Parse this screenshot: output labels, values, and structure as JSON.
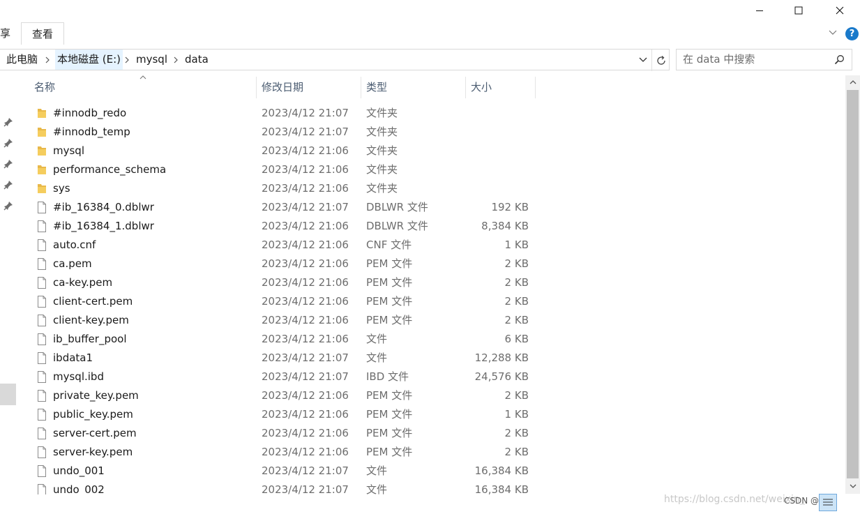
{
  "ribbon": {
    "tab_partial": "享",
    "tab_view": "查看"
  },
  "address": {
    "crumbs": [
      "此电脑",
      "本地磁盘 (E:)",
      "mysql",
      "data"
    ]
  },
  "search": {
    "placeholder": "在 data 中搜索"
  },
  "columns": {
    "name": "名称",
    "date": "修改日期",
    "type": "类型",
    "size": "大小"
  },
  "files": [
    {
      "name": "#innodb_redo",
      "date": "2023/4/12 21:07",
      "type": "文件夹",
      "size": "",
      "icon": "folder-icon"
    },
    {
      "name": "#innodb_temp",
      "date": "2023/4/12 21:07",
      "type": "文件夹",
      "size": "",
      "icon": "folder-icon"
    },
    {
      "name": "mysql",
      "date": "2023/4/12 21:06",
      "type": "文件夹",
      "size": "",
      "icon": "folder-icon"
    },
    {
      "name": "performance_schema",
      "date": "2023/4/12 21:06",
      "type": "文件夹",
      "size": "",
      "icon": "folder-icon"
    },
    {
      "name": "sys",
      "date": "2023/4/12 21:06",
      "type": "文件夹",
      "size": "",
      "icon": "folder-icon"
    },
    {
      "name": "#ib_16384_0.dblwr",
      "date": "2023/4/12 21:07",
      "type": "DBLWR 文件",
      "size": "192 KB",
      "icon": "file-icon"
    },
    {
      "name": "#ib_16384_1.dblwr",
      "date": "2023/4/12 21:06",
      "type": "DBLWR 文件",
      "size": "8,384 KB",
      "icon": "file-icon"
    },
    {
      "name": "auto.cnf",
      "date": "2023/4/12 21:06",
      "type": "CNF 文件",
      "size": "1 KB",
      "icon": "file-icon"
    },
    {
      "name": "ca.pem",
      "date": "2023/4/12 21:06",
      "type": "PEM 文件",
      "size": "2 KB",
      "icon": "file-icon"
    },
    {
      "name": "ca-key.pem",
      "date": "2023/4/12 21:06",
      "type": "PEM 文件",
      "size": "2 KB",
      "icon": "file-icon"
    },
    {
      "name": "client-cert.pem",
      "date": "2023/4/12 21:06",
      "type": "PEM 文件",
      "size": "2 KB",
      "icon": "file-icon"
    },
    {
      "name": "client-key.pem",
      "date": "2023/4/12 21:06",
      "type": "PEM 文件",
      "size": "2 KB",
      "icon": "file-icon"
    },
    {
      "name": "ib_buffer_pool",
      "date": "2023/4/12 21:06",
      "type": "文件",
      "size": "6 KB",
      "icon": "file-icon"
    },
    {
      "name": "ibdata1",
      "date": "2023/4/12 21:07",
      "type": "文件",
      "size": "12,288 KB",
      "icon": "file-icon"
    },
    {
      "name": "mysql.ibd",
      "date": "2023/4/12 21:07",
      "type": "IBD 文件",
      "size": "24,576 KB",
      "icon": "file-icon"
    },
    {
      "name": "private_key.pem",
      "date": "2023/4/12 21:06",
      "type": "PEM 文件",
      "size": "2 KB",
      "icon": "file-icon"
    },
    {
      "name": "public_key.pem",
      "date": "2023/4/12 21:06",
      "type": "PEM 文件",
      "size": "1 KB",
      "icon": "file-icon"
    },
    {
      "name": "server-cert.pem",
      "date": "2023/4/12 21:06",
      "type": "PEM 文件",
      "size": "2 KB",
      "icon": "file-icon"
    },
    {
      "name": "server-key.pem",
      "date": "2023/4/12 21:06",
      "type": "PEM 文件",
      "size": "2 KB",
      "icon": "file-icon"
    },
    {
      "name": "undo_001",
      "date": "2023/4/12 21:07",
      "type": "文件",
      "size": "16,384 KB",
      "icon": "file-icon"
    },
    {
      "name": "undo_002",
      "date": "2023/4/12 21:07",
      "type": "文件",
      "size": "16,384 KB",
      "icon": "file-icon"
    }
  ],
  "watermark": {
    "url": "https://blog.csdn.net/weixin_",
    "brand": "CSDN @"
  },
  "colors": {
    "accent": "#1979ca",
    "folder": "#e8b84a",
    "header_text": "#4a5b70"
  }
}
